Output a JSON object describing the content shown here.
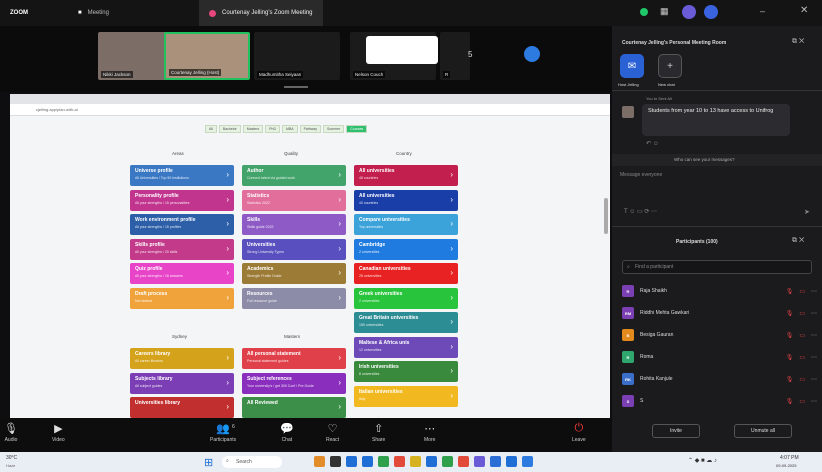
{
  "topbar": {
    "app": "ZOOM",
    "tabs": [
      {
        "label": "Meeting"
      },
      {
        "label": "Courtenay Jelling's Zoom Meeting"
      }
    ]
  },
  "participants_strip": [
    {
      "name": "Nikki Jackson",
      "color": "#8a7b70"
    },
    {
      "name": "Courtenay Jelling (Host)",
      "color": "#b39a84"
    },
    {
      "name": "Madhumitha Seiyaan",
      "color": "#1b1b1b"
    },
    {
      "name": "Nelson Couch",
      "color": "#1b1b1b"
    },
    {
      "name": "R",
      "color": "#1b1b1b"
    }
  ],
  "strip_count": "5",
  "share": {
    "url": "cjelling.app/plan-with-ai",
    "filter_tabs": [
      "All",
      "Bachelor",
      "Masters",
      "PhD",
      "MBA",
      "Pathway",
      "Summer",
      "Courses"
    ],
    "col_heads": [
      "Areas",
      "Quality",
      "Country",
      "Sydney",
      "Masters"
    ],
    "columns": [
      [
        {
          "t": "Universe profile",
          "s": "All Universities / Top 50 institutions",
          "c": "#3a78c4"
        },
        {
          "t": "Personality profile",
          "s": "All your strengths / 15 personalities",
          "c": "#c2358f"
        },
        {
          "t": "Work environment profile",
          "s": "All your strengths / 15 profiles",
          "c": "#2c5fa8"
        },
        {
          "t": "Skills profile",
          "s": "All your strengths / 20 skills",
          "c": "#c23a89"
        },
        {
          "t": "Quiz profile",
          "s": "All your strengths / 15 answers",
          "c": "#e844c8"
        },
        {
          "t": "Draft process",
          "s": "Not started",
          "c": "#f0a33b"
        }
      ],
      [
        {
          "t": "Author",
          "s": "Connect talent via guided work",
          "c": "#42a36b"
        },
        {
          "t": "Statistics",
          "s": "Statistics 2022",
          "c": "#e26e9b"
        },
        {
          "t": "Skills",
          "s": "Skills guide 2022",
          "c": "#8e5bc6"
        },
        {
          "t": "Universities",
          "s": "Strong University Types",
          "c": "#5a4fbf"
        },
        {
          "t": "Academics",
          "s": "Strength Profile Guide",
          "c": "#9c7b37"
        },
        {
          "t": "Resources",
          "s": "Full resource guide",
          "c": "#8c8ca8"
        }
      ],
      [
        {
          "t": "All universities",
          "s": "48 countries",
          "c": "#c21e4e"
        },
        {
          "t": "All universities",
          "s": "40 countries",
          "c": "#1a3ea8"
        },
        {
          "t": "Compare universities",
          "s": "Top universities",
          "c": "#3ba3d9"
        },
        {
          "t": "Cambridge",
          "s": "2 universities",
          "c": "#1f7be0"
        },
        {
          "t": "Canadian universities",
          "s": "25 universities",
          "c": "#e82222"
        },
        {
          "t": "Greek universities",
          "s": "2 universities",
          "c": "#27c43c"
        },
        {
          "t": "Great Britain universities",
          "s": "150 universities",
          "c": "#2d8d94"
        },
        {
          "t": "Maltese & Africa unis",
          "s": "12 universities",
          "c": "#6d4ab8"
        },
        {
          "t": "Irish universities",
          "s": "8 universities",
          "c": "#3a8a3e"
        },
        {
          "t": "Italian universities",
          "s": "Italy",
          "c": "#f2b81f"
        }
      ],
      [
        {
          "t": "Careers library",
          "s": "All career libraries",
          "c": "#d4a21b"
        },
        {
          "t": "Subjects library",
          "s": "All subject guides",
          "c": "#7b3eb4"
        },
        {
          "t": "Universities library",
          "s": "",
          "c": "#c22f2f"
        }
      ],
      [
        {
          "t": "All personal statement",
          "s": "Personal statement guides",
          "c": "#e0404a"
        },
        {
          "t": "Subject references",
          "s": "Your university's / get 300 Conf / Pre Guide",
          "c": "#8a2fbd"
        },
        {
          "t": "All Reviewed",
          "s": "",
          "c": "#3c8f48"
        }
      ]
    ]
  },
  "toolbar": {
    "items": [
      {
        "label": "Audio",
        "icon": "mic-icon"
      },
      {
        "label": "Video",
        "icon": "video-icon"
      },
      {
        "label": "Participants",
        "icon": "participants-icon"
      },
      {
        "label": "Chat",
        "icon": "chat-icon"
      },
      {
        "label": "React",
        "icon": "react-icon"
      },
      {
        "label": "Share",
        "icon": "share-icon"
      },
      {
        "label": "More",
        "icon": "more-icon"
      },
      {
        "label": "Leave",
        "icon": "leave-icon"
      }
    ],
    "participants_count": "6"
  },
  "panel": {
    "title": "Courtenay Jelling's Personal Meeting Room",
    "chat_btns": [
      "Host Jelling",
      "New chat"
    ],
    "chat_sender": "You to Sent All",
    "chat_message": "Students from year 10 to 13 have access to Unifrog",
    "who_see": "Who can see your messages?",
    "message_placeholder": "Message everyone",
    "participants_title": "Participants (100)",
    "search_placeholder": "Find a participant",
    "people": [
      {
        "initials": "R",
        "name": "Raja Shaikh",
        "c": "#7a3fb3"
      },
      {
        "initials": "RM",
        "name": "Riddhi Mehta Gawkari",
        "c": "#7a3fb3"
      },
      {
        "initials": "B",
        "name": "Besiga Gauran",
        "c": "#e48a1d"
      },
      {
        "initials": "R",
        "name": "Roma",
        "c": "#2ea66e"
      },
      {
        "initials": "RK",
        "name": "Rohita Kanjule",
        "c": "#3a6ec8"
      },
      {
        "initials": "S",
        "name": "S",
        "c": "#7a3fb3"
      }
    ],
    "invite": "Invite",
    "unmute_all": "Unmute all"
  },
  "taskbar": {
    "weather": "30°C",
    "weather_desc": "Haze",
    "search": "Search",
    "time": "4:07 PM",
    "date": "09-09-2025"
  }
}
